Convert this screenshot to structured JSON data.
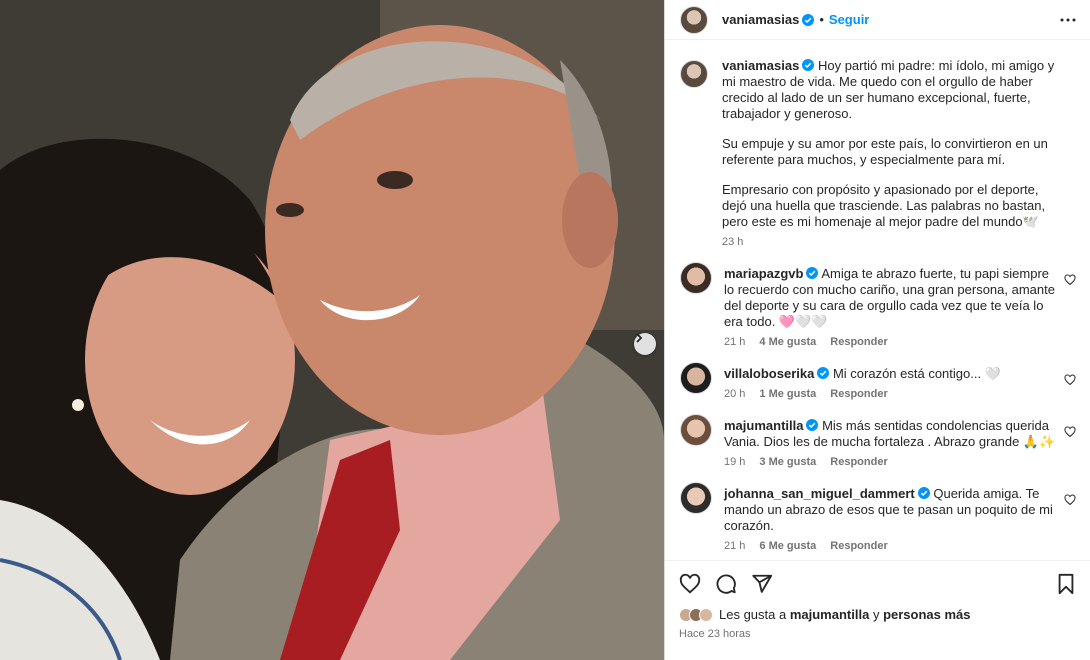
{
  "post": {
    "username": "vaniamasias",
    "follow_label": "Seguir",
    "caption_paragraphs": [
      "Hoy partió mi padre: mi ídolo, mi amigo y mi maestro de vida. Me quedo con el orgullo de haber crecido al lado de un ser humano excepcional, fuerte, trabajador y generoso.",
      "Su empuje y su amor por este país, lo convirtieron en un referente para muchos, y especialmente para mí.",
      "Empresario con propósito y apasionado por el deporte, dejó una huella que trasciende. Las palabras no bastan, pero este es mi homenaje al mejor padre del mundo🕊️"
    ],
    "caption_time": "23 h"
  },
  "comments": [
    {
      "username": "mariapazgvb",
      "text": "Amiga te abrazo fuerte, tu papi siempre lo recuerdo con mucho cariño, una gran persona, amante del deporte y su cara de orgullo cada vez que te veía lo era todo. 🩷🤍🤍",
      "time": "21 h",
      "likes": "4 Me gusta",
      "reply": "Responder"
    },
    {
      "username": "villaloboserika",
      "text": "Mi corazón está contigo... 🤍",
      "time": "20 h",
      "likes": "1 Me gusta",
      "reply": "Responder"
    },
    {
      "username": "majumantilla",
      "text": "Mis más sentidas condolencias querida Vania. Dios les de mucha fortaleza . Abrazo grande 🙏✨",
      "time": "19 h",
      "likes": "3 Me gusta",
      "reply": "Responder"
    },
    {
      "username": "johanna_san_miguel_dammert",
      "text": "Querida amiga. Te mando un abrazo de esos que te pasan un poquito de mi corazón.",
      "time": "21 h",
      "likes": "6 Me gusta",
      "reply": "Responder"
    }
  ],
  "footer": {
    "likes_prefix": "Les gusta a",
    "likes_user": "majumantilla",
    "likes_conj": "y",
    "likes_others": "personas más",
    "posted_ago": "Hace 23 horas"
  },
  "icons": [
    "verified-badge-icon",
    "more-options-icon",
    "heart-icon",
    "comment-icon",
    "share-icon",
    "bookmark-icon",
    "carousel-next-icon"
  ],
  "colors": {
    "accent": "#0095f6",
    "muted": "#737373",
    "text": "#262626"
  }
}
